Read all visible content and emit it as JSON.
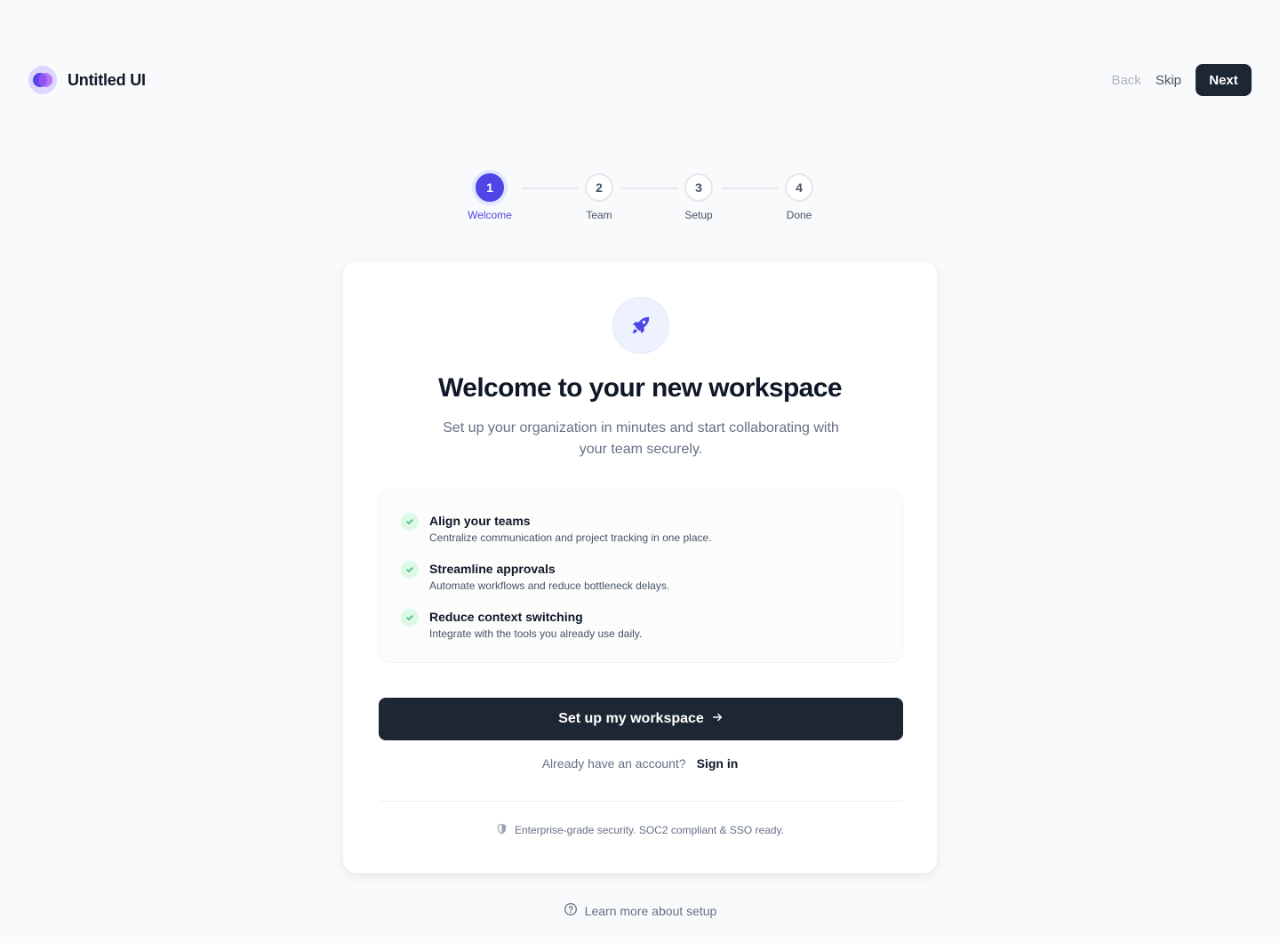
{
  "brand": {
    "name": "Untitled UI"
  },
  "nav": {
    "back_label": "Back",
    "skip_label": "Skip",
    "next_label": "Next"
  },
  "steps": [
    {
      "num": "1",
      "label": "Welcome",
      "active": true
    },
    {
      "num": "2",
      "label": "Team",
      "active": false
    },
    {
      "num": "3",
      "label": "Setup",
      "active": false
    },
    {
      "num": "4",
      "label": "Done",
      "active": false
    }
  ],
  "card": {
    "icon": "rocket-icon",
    "title": "Welcome to your new workspace",
    "subtitle": "Set up your organization in minutes and start collaborating with your team securely.",
    "features": [
      {
        "title": "Align your teams",
        "desc": "Centralize communication and project tracking in one place."
      },
      {
        "title": "Streamline approvals",
        "desc": "Automate workflows and reduce bottleneck delays."
      },
      {
        "title": "Reduce context switching",
        "desc": "Integrate with the tools you already use daily."
      }
    ],
    "cta_label": "Set up my workspace",
    "signin_question": "Already have an account?",
    "signin_link": "Sign in",
    "security_note": "Enterprise-grade security. SOC2 compliant & SSO ready."
  },
  "footer": {
    "learn_more": "Learn more about setup"
  },
  "colors": {
    "accent": "#4f46e5",
    "primary_button": "#1d2633",
    "success": "#17b26a"
  }
}
